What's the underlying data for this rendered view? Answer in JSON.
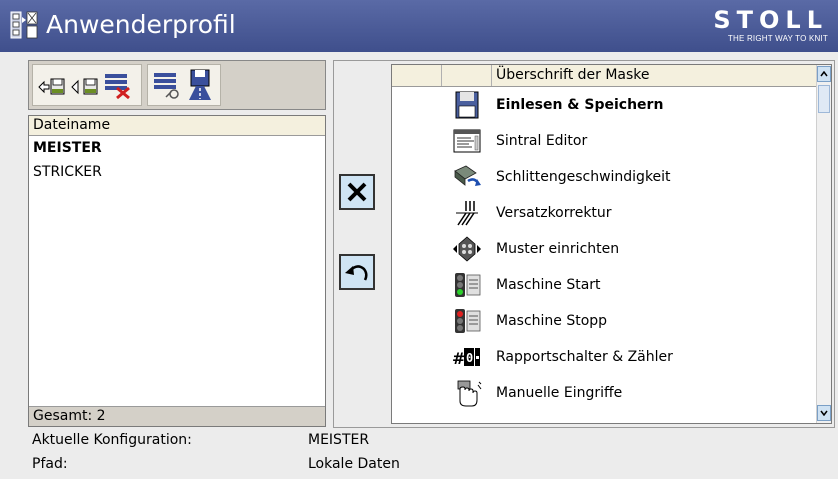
{
  "titlebar": {
    "title": "Anwenderprofil",
    "brand": "STOLL",
    "tagline": "THE RIGHT WAY TO KNIT"
  },
  "file_list": {
    "header": "Dateiname",
    "items": [
      {
        "name": "MEISTER",
        "bold": true
      },
      {
        "name": "STRICKER",
        "bold": false
      }
    ],
    "footer": "Gesamt:  2"
  },
  "menu": {
    "header": "Überschrift der Maske",
    "items": [
      {
        "label": "Einlesen & Speichern",
        "icon": "floppy-disk-icon",
        "bold": true
      },
      {
        "label": "Sintral Editor",
        "icon": "text-editor-icon",
        "bold": false
      },
      {
        "label": "Schlittengeschwindigkeit",
        "icon": "carriage-speed-icon",
        "bold": false
      },
      {
        "label": "Versatzkorrektur",
        "icon": "racking-correction-icon",
        "bold": false
      },
      {
        "label": "Muster einrichten",
        "icon": "pattern-setup-icon",
        "bold": false
      },
      {
        "label": "Maschine Start",
        "icon": "machine-start-icon",
        "bold": false
      },
      {
        "label": "Maschine Stopp",
        "icon": "machine-stop-icon",
        "bold": false
      },
      {
        "label": "Rapportschalter & Zähler",
        "icon": "counter-icon",
        "bold": false
      },
      {
        "label": "Manuelle Eingriffe",
        "icon": "manual-intervention-icon",
        "bold": false
      }
    ]
  },
  "status": {
    "config_label": "Aktuelle Konfiguration:",
    "config_value": "MEISTER",
    "path_label": "Pfad:",
    "path_value": "Lokale Daten"
  },
  "colors": {
    "titlebar": "#4a5a98",
    "header_bg": "#f4f0de",
    "button_bg": "#cfe4f4"
  }
}
